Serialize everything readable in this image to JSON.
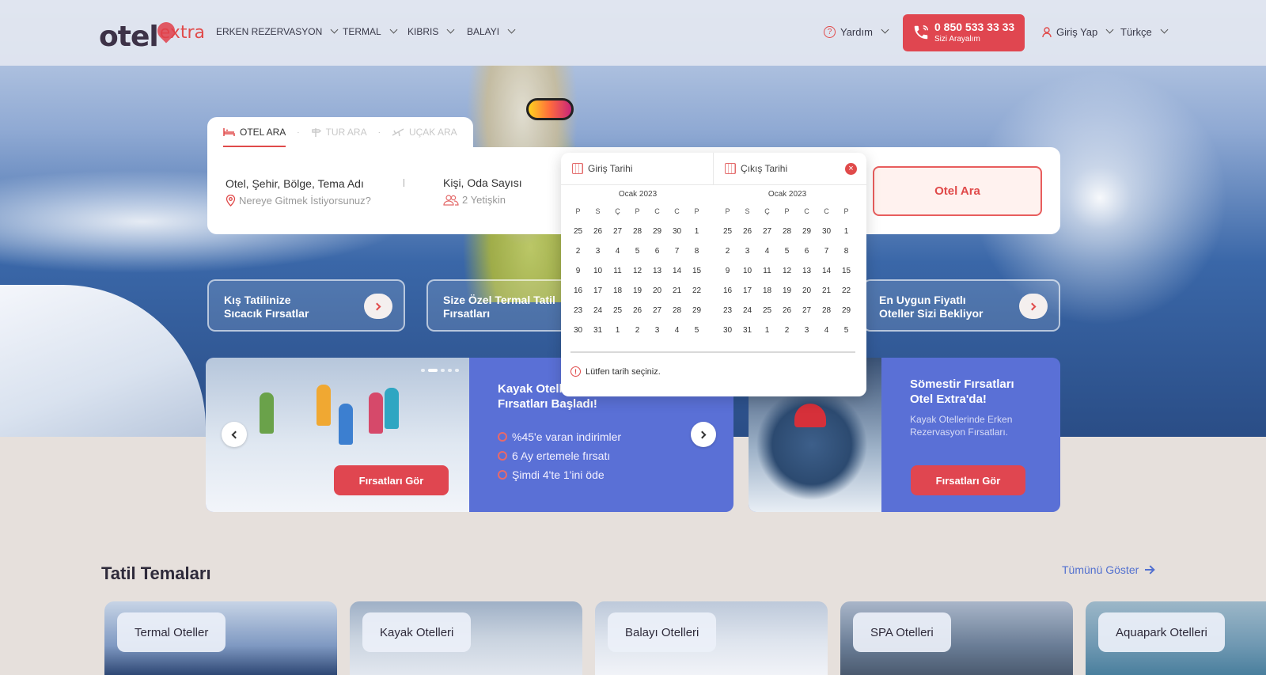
{
  "header": {
    "logo_main": "otel",
    "logo_extra": "extra",
    "nav": [
      "ERKEN REZERVASYON",
      "TERMAL",
      "KIBRIS",
      "BALAYI"
    ],
    "help": "Yardım",
    "phone_number": "0 850 533 33 33",
    "phone_sub": "Sizi Arayalım",
    "login": "Giriş Yap",
    "language": "Türkçe"
  },
  "search": {
    "tabs": [
      "OTEL ARA",
      "TUR ARA",
      "UÇAK ARA"
    ],
    "destination_title": "Otel, Şehir, Bölge, Tema Adı",
    "destination_placeholder": "Nereye Gitmek İstiyorsunuz?",
    "guests_title": "Kişi, Oda Sayısı",
    "guests_value": "2 Yetişkin",
    "search_button": "Otel Ara"
  },
  "calendar": {
    "checkin_label": "Giriş Tarihi",
    "checkout_label": "Çıkış Tarihi",
    "months": [
      {
        "title": "Ocak 2023",
        "days": [
          "25",
          "26",
          "27",
          "28",
          "29",
          "30",
          "1",
          "2",
          "3",
          "4",
          "5",
          "6",
          "7",
          "8",
          "9",
          "10",
          "11",
          "12",
          "13",
          "14",
          "15",
          "16",
          "17",
          "18",
          "19",
          "20",
          "21",
          "22",
          "23",
          "24",
          "25",
          "26",
          "27",
          "28",
          "29",
          "30",
          "31",
          "1",
          "2",
          "3",
          "4",
          "5"
        ]
      },
      {
        "title": "Ocak 2023",
        "days": [
          "25",
          "26",
          "27",
          "28",
          "29",
          "30",
          "1",
          "2",
          "3",
          "4",
          "5",
          "6",
          "7",
          "8",
          "9",
          "10",
          "11",
          "12",
          "13",
          "14",
          "15",
          "16",
          "17",
          "18",
          "19",
          "20",
          "21",
          "22",
          "23",
          "24",
          "25",
          "26",
          "27",
          "28",
          "29",
          "30",
          "31",
          "1",
          "2",
          "3",
          "4",
          "5"
        ]
      }
    ],
    "weekdays": [
      "P",
      "S",
      "Ç",
      "P",
      "C",
      "C",
      "P"
    ],
    "warning": "Lütfen tarih seçiniz."
  },
  "promos": [
    {
      "line1": "Kış Tatilinize",
      "line2": "Sıcacık Fırsatlar"
    },
    {
      "line1": "Size Özel Termal Tatil",
      "line2": "Fırsatları"
    },
    {
      "line1": "En Uygun Fiyatlı",
      "line2": "Oteller Sizi Bekliyor"
    }
  ],
  "banner1": {
    "title_line1": "Kayak Otelle",
    "title_line2": "Fırsatları Başladı!",
    "bullets": [
      "%45'e varan indirimler",
      "6 Ay ertemele fırsatı",
      "Şimdi 4'te 1'ini öde"
    ],
    "button": "Fırsatları Gör"
  },
  "banner2": {
    "title_line1": "Sömestir Fırsatları",
    "title_line2": "Otel Extra'da!",
    "desc_line1": "Kayak Otellerinde Erken",
    "desc_line2": "Rezervasyon Fırsatları.",
    "button": "Fırsatları Gör"
  },
  "themes": {
    "title": "Tatil Temaları",
    "see_all": "Tümünü Göster",
    "items": [
      "Termal Oteller",
      "Kayak Otelleri",
      "Balayı Otelleri",
      "SPA Otelleri",
      "Aquapark Otelleri"
    ]
  },
  "colors": {
    "brand_red": "#e04650",
    "brand_blue": "#5a70d6",
    "brand_dark": "#3d3247"
  }
}
